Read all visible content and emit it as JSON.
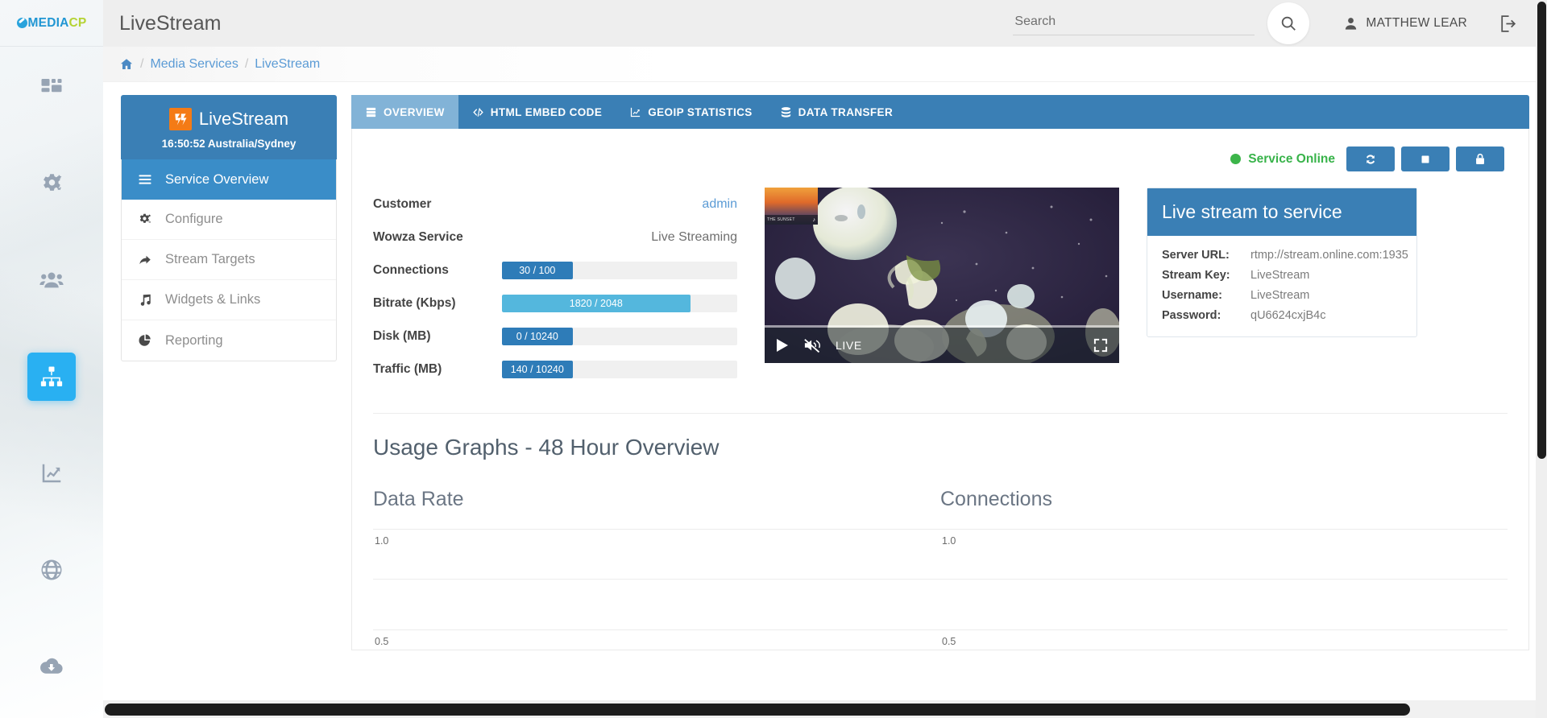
{
  "brand": {
    "logo_part1": "MEDIA",
    "logo_part2": "CP",
    "logo_icon": "circle-swoosh-icon"
  },
  "rail": {
    "items": [
      {
        "name": "dashboard",
        "icon": "dashboard-grid-icon",
        "active": false
      },
      {
        "name": "settings",
        "icon": "gears-icon",
        "active": false
      },
      {
        "name": "users",
        "icon": "users-icon",
        "active": false
      },
      {
        "name": "media-services",
        "icon": "sitemap-icon",
        "active": true
      },
      {
        "name": "statistics",
        "icon": "chart-line-icon",
        "active": false
      },
      {
        "name": "network",
        "icon": "globe-icon",
        "active": false
      },
      {
        "name": "downloads",
        "icon": "cloud-download-icon",
        "active": false
      }
    ],
    "active_color": "#29b0f2"
  },
  "header": {
    "title": "LiveStream",
    "search": {
      "placeholder": "Search",
      "value": "",
      "icon": "search-icon"
    },
    "user": {
      "name": "MATTHEW LEAR",
      "icon": "person-icon"
    },
    "logout": {
      "icon": "logout-icon",
      "label": "Logout"
    }
  },
  "breadcrumb": {
    "home_icon": "home-icon",
    "separator": "/",
    "items": [
      {
        "label": "Media Services"
      },
      {
        "label": "LiveStream"
      }
    ]
  },
  "service_panel": {
    "icon": "wowza-lightning-icon",
    "name": "LiveStream",
    "time": "16:50:52 Australia/Sydney",
    "menu": [
      {
        "label": "Service Overview",
        "icon": "hamburger-icon",
        "active": true
      },
      {
        "label": "Configure",
        "icon": "gears-icon",
        "active": false
      },
      {
        "label": "Stream Targets",
        "icon": "share-arrow-icon",
        "active": false
      },
      {
        "label": "Widgets & Links",
        "icon": "music-note-icon",
        "active": false
      },
      {
        "label": "Reporting",
        "icon": "pie-chart-icon",
        "active": false
      }
    ]
  },
  "tabs": [
    {
      "label": "OVERVIEW",
      "icon": "server-icon",
      "active": true
    },
    {
      "label": "HTML EMBED CODE",
      "icon": "code-icon",
      "active": false
    },
    {
      "label": "GEOIP STATISTICS",
      "icon": "chart-line-icon",
      "active": false
    },
    {
      "label": "DATA TRANSFER",
      "icon": "database-icon",
      "active": false
    }
  ],
  "status": {
    "label": "Service Online",
    "color": "#38b34a",
    "actions": [
      {
        "name": "restart",
        "icon": "refresh-icon"
      },
      {
        "name": "stop",
        "icon": "stop-square-icon"
      },
      {
        "name": "lock",
        "icon": "lock-icon"
      }
    ]
  },
  "stats": {
    "customer": {
      "label": "Customer",
      "value": "admin"
    },
    "wowza_service": {
      "label": "Wowza Service",
      "value": "Live Streaming"
    },
    "bars": [
      {
        "label": "Connections",
        "text": "30 / 100",
        "used": 30,
        "total": 100,
        "percent": 30,
        "color": "#2e7cb8"
      },
      {
        "label": "Bitrate (Kbps)",
        "text": "1820 / 2048",
        "used": 1820,
        "total": 2048,
        "percent": 80,
        "color": "#54b7dd"
      },
      {
        "label": "Disk (MB)",
        "text": "0 / 10240",
        "used": 0,
        "total": 10240,
        "percent": 30,
        "color": "#2e7cb8"
      },
      {
        "label": "Traffic (MB)",
        "text": "140 / 10240",
        "used": 140,
        "total": 10240,
        "percent": 30,
        "color": "#2e7cb8"
      }
    ]
  },
  "video": {
    "play_icon": "play-icon",
    "mute_icon": "volume-muted-icon",
    "live_label": "LIVE",
    "fullscreen_icon": "fullscreen-icon",
    "thumbnail_label": "THE SUNSET",
    "thumbnail_note": "♪"
  },
  "live_card": {
    "title": "Live stream to service",
    "rows": [
      {
        "key": "Server URL:",
        "value": "rtmp://stream.online.com:1935"
      },
      {
        "key": "Stream Key:",
        "value": "LiveStream"
      },
      {
        "key": "Username:",
        "value": "LiveStream"
      },
      {
        "key": "Password:",
        "value": "qU6624cxjB4c"
      }
    ]
  },
  "usage": {
    "title": "Usage Graphs - 48 Hour Overview"
  },
  "chart_data": [
    {
      "type": "line",
      "title": "Data Rate",
      "xlabel": "",
      "ylabel": "",
      "x": [],
      "values": [],
      "yticks": [
        "1.0",
        "0.5"
      ],
      "ylim": [
        0,
        1.0
      ],
      "grid": true,
      "legend": "none",
      "note": "empty plot area, horizontal gridlines only"
    },
    {
      "type": "line",
      "title": "Connections",
      "xlabel": "",
      "ylabel": "",
      "x": [],
      "values": [],
      "yticks": [
        "1.0",
        "0.5"
      ],
      "ylim": [
        0,
        1.0
      ],
      "grid": true,
      "legend": "none",
      "note": "empty plot area, horizontal gridlines only"
    }
  ],
  "scrollbars": {
    "vertical": "vertical-scrollbar",
    "horizontal": "horizontal-scrollbar"
  }
}
